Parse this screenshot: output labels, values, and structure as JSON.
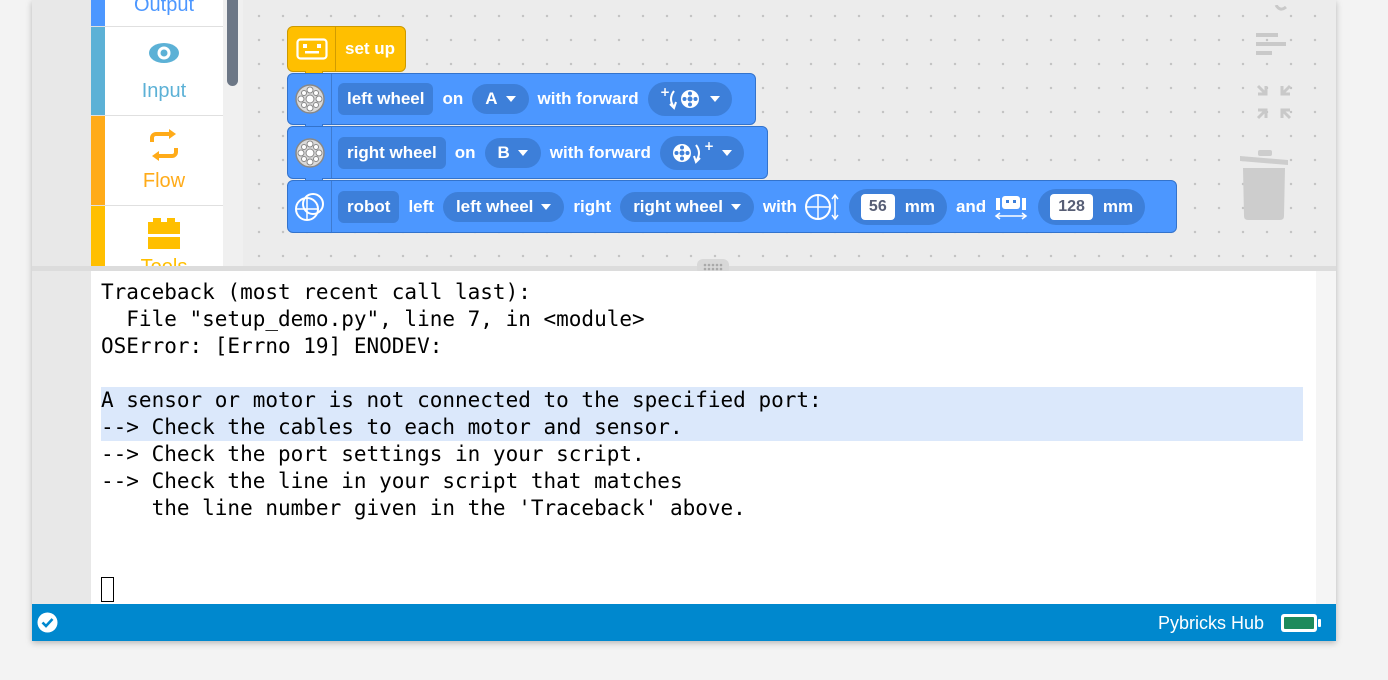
{
  "sidebar": {
    "categories": [
      {
        "label": "Output",
        "icon": "output-icon",
        "color": "#4c97ff"
      },
      {
        "label": "Input",
        "icon": "eye-icon",
        "color": "#5cb1d6"
      },
      {
        "label": "Flow",
        "icon": "loop-arrows-icon",
        "color": "#ffab19"
      },
      {
        "label": "Tools",
        "icon": "blocks-icon",
        "color": "#ffbf00"
      }
    ]
  },
  "blocks": {
    "setup": {
      "label": "set up"
    },
    "left_motor": {
      "name": "left wheel",
      "on": "on",
      "port": "A",
      "with_forward": "with forward"
    },
    "right_motor": {
      "name": "right wheel",
      "on": "on",
      "port": "B",
      "with_forward": "with forward"
    },
    "robot": {
      "name": "robot",
      "left": "left",
      "left_value": "left wheel",
      "right": "right",
      "right_value": "right wheel",
      "with": "with",
      "wheel_diameter": "56",
      "unit1": "mm",
      "and": "and",
      "axle_track": "128",
      "unit2": "mm"
    }
  },
  "terminal": {
    "lines": [
      "Traceback (most recent call last):",
      "  File \"setup_demo.py\", line 7, in <module>",
      "OSError: [Errno 19] ENODEV:",
      "",
      "A sensor or motor is not connected to the specified port:",
      "--> Check the cables to each motor and sensor.",
      "--> Check the port settings in your script.",
      "--> Check the line in your script that matches",
      "    the line number given in the 'Traceback' above."
    ]
  },
  "status": {
    "hub_name": "Pybricks Hub",
    "connected_icon": "check-circle-icon",
    "battery_icon": "battery-icon",
    "battery_color": "#1e8a5b"
  },
  "colors": {
    "motion_blue": "#4c97ff",
    "setup_yellow": "#ffbf00",
    "status_blue": "#0088ce"
  }
}
